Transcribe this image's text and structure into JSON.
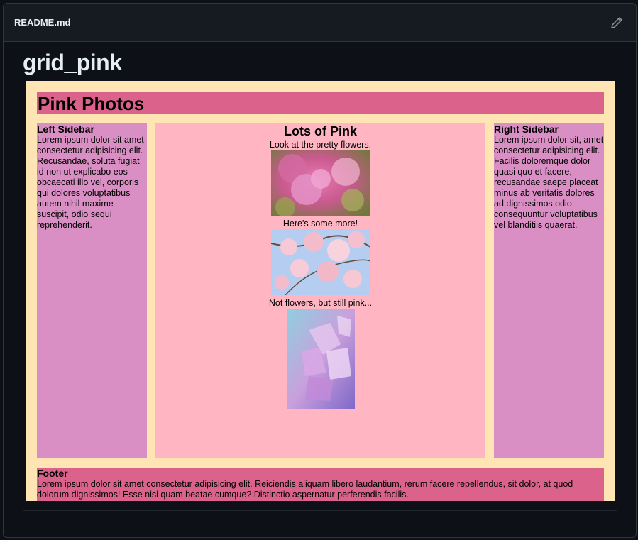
{
  "header": {
    "file_name": "README.md"
  },
  "readme": {
    "title": "grid_pink"
  },
  "preview": {
    "heading": "Pink Photos",
    "left_sidebar": {
      "title": "Left Sidebar",
      "text": "Lorem ipsum dolor sit amet consectetur adipisicing elit. Recusandae, soluta fugiat id non ut explicabo eos obcaecati illo vel, corporis qui dolores voluptatibus autem nihil maxime suscipit, odio sequi reprehenderit."
    },
    "main": {
      "title": "Lots of Pink",
      "caption1": "Look at the pretty flowers.",
      "caption2": "Here's some more!",
      "caption3": "Not flowers, but still pink..."
    },
    "right_sidebar": {
      "title": "Right Sidebar",
      "text": "Lorem ipsum dolor sit, amet consectetur adipisicing elit. Facilis doloremque dolor quasi quo et facere, recusandae saepe placeat minus ab veritatis dolores ad dignissimos odio consequuntur voluptatibus vel blanditiis quaerat."
    },
    "footer": {
      "title": "Footer",
      "text": "Lorem ipsum dolor sit amet consectetur adipisicing elit. Reiciendis aliquam libero laudantium, rerum facere repellendus, sit dolor, at quod dolorum dignissimos! Esse nisi quam beatae cumque? Distinctio aspernatur perferendis facilis."
    },
    "colors": {
      "background": "#ffe5b4",
      "header": "#db628b",
      "sidebar": "#da8fc4",
      "main": "#ffb6c2"
    }
  },
  "icons": {
    "edit": "pencil-icon"
  }
}
